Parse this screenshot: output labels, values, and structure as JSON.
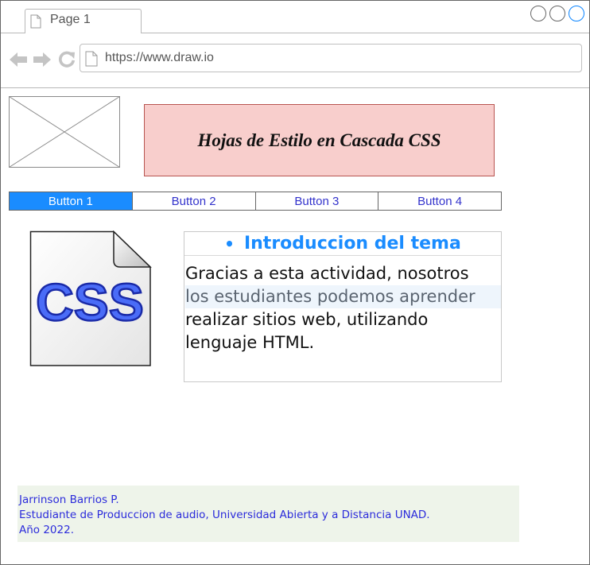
{
  "browser": {
    "tab_label": "Page 1",
    "url": "https://www.draw.io",
    "icons": {
      "tab_page": "page-icon",
      "back": "arrow-left-icon",
      "forward": "arrow-right-icon",
      "reload": "reload-icon",
      "url_page": "page-icon",
      "window_controls": [
        "circle-icon",
        "circle-icon",
        "circle-icon"
      ]
    }
  },
  "header": {
    "image_placeholder": "image-placeholder-icon",
    "title": "Hojas de Estilo en Cascada CSS",
    "title_background": "#f8cecc",
    "title_border": "#b85450"
  },
  "buttons": [
    {
      "label": "Button 1",
      "active": true
    },
    {
      "label": "Button 2",
      "active": false
    },
    {
      "label": "Button 3",
      "active": false
    },
    {
      "label": "Button 4",
      "active": false
    }
  ],
  "colors": {
    "accent": "#1a8cff",
    "button_text": "#3333cc",
    "footer_text": "#2b2bdb",
    "footer_background": "#eef4ea"
  },
  "css_file_icon": {
    "icon": "css-file-icon",
    "text": "CSS"
  },
  "content": {
    "heading": "Introduccion del tema",
    "lines": [
      "Gracias a esta actividad, nosotros",
      "los estudiantes podemos aprender",
      "realizar sitios web, utilizando",
      "lenguaje HTML."
    ]
  },
  "footer": {
    "lines": [
      "Jarrinson Barrios P.",
      "Estudiante de Produccion de audio, Universidad Abierta y a Distancia UNAD.",
      "Año 2022."
    ]
  }
}
